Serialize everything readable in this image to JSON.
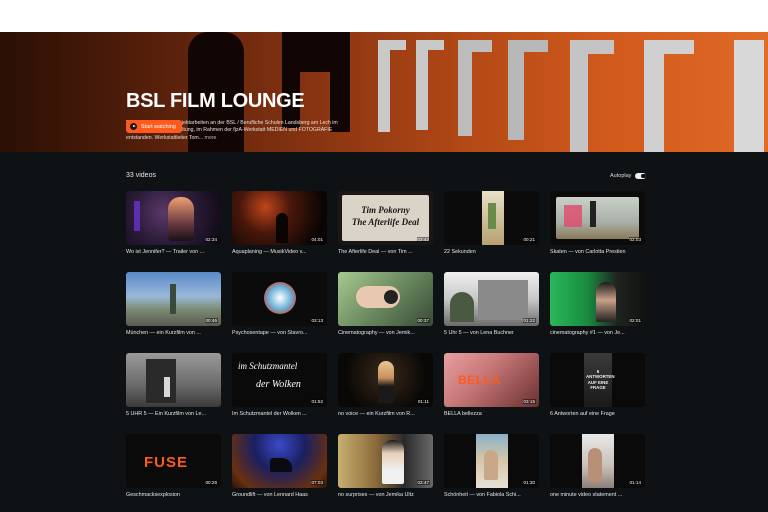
{
  "hero": {
    "title": "BSL FILM LOUNGE",
    "description": "Diese Filme sind als Projektarbeiten an der BSL / Berufliche Schulen Landsberg am Lech im Fachbereich FOS-Gestaltung, im Rahmen der fjzA-Werkstatt MEDIEN und FOTOGRAFIE entstanden. Werkstattleiter Tom...",
    "more_label": "more",
    "watch_label": "Start watching"
  },
  "videos_count": "33 videos",
  "autoplay_label": "Autoplay",
  "colors": {
    "accent": "#ff5a1e",
    "background": "#0e1215"
  },
  "videos": [
    {
      "title": "Wo ist Jennifer? — Trailer von ...",
      "duration": "02:34"
    },
    {
      "title": "Aquaplaning — MusikVideo v...",
      "duration": "04:01"
    },
    {
      "title": "The Afterlife Deal — von Tim ...",
      "duration": "03:43",
      "overlay_text_1": "Tim Pokorny",
      "overlay_text_2": "The Afterlife Deal"
    },
    {
      "title": "22 Sekunden",
      "duration": "00:21"
    },
    {
      "title": "Skaten — von Carlotta Prestien",
      "duration": "02:03"
    },
    {
      "title": "München — ein Kurzfilm von ...",
      "duration": "00:46"
    },
    {
      "title": "Psychosentape — von Stavro...",
      "duration": "03:13"
    },
    {
      "title": "Cinematography — von Jemik...",
      "duration": "00:37"
    },
    {
      "title": "5 Uhr 5 — von Lena Buchner",
      "duration": "01:22"
    },
    {
      "title": "cinematography #1 — von Je...",
      "duration": "02:01"
    },
    {
      "title": "5 UHR 5 — Ein Kurzfilm von Le...",
      "duration": ""
    },
    {
      "title": "Im Schutzmantel der Wolken ...",
      "duration": "01:52",
      "overlay_text_1": "im Schutzmantel",
      "overlay_text_2": "der Wolken"
    },
    {
      "title": "no voice — ein Kurzfilm von R...",
      "duration": "01:11"
    },
    {
      "title": "BELLA bellezza",
      "duration": "03:15",
      "overlay_text_1": "BELLA"
    },
    {
      "title": "6 Antworten auf eine Frage",
      "duration": "",
      "overlay_text_1": "6 ANTWORTEN AUF EINE FRAGE"
    },
    {
      "title": "Geschmacksexplosion",
      "duration": "00:26",
      "overlay_text_1": "FUSE"
    },
    {
      "title": "Groundlift — von Lennard Haas",
      "duration": "07:03"
    },
    {
      "title": "no surprises — von Jemika Ultz",
      "duration": "03:47"
    },
    {
      "title": "Schönheit — von Fabiola Schi...",
      "duration": "01:30"
    },
    {
      "title": "one minute video statement ...",
      "duration": "01:14"
    }
  ]
}
